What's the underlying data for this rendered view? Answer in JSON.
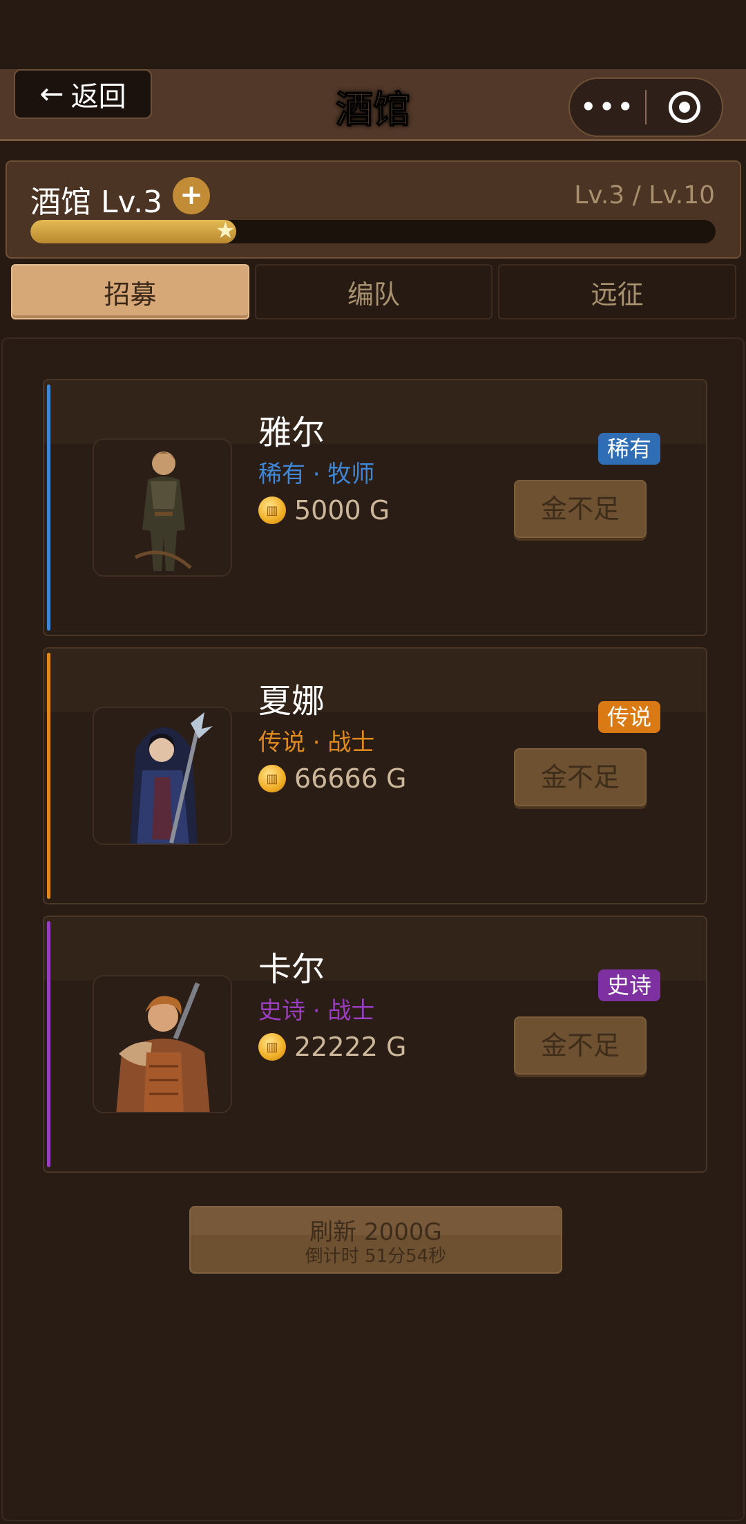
{
  "header": {
    "back_arrow": "←",
    "back_label": "返回",
    "title": "酒馆",
    "more_icon": "•••"
  },
  "level": {
    "name": "酒馆 Lv.3",
    "plus": "+",
    "range": "Lv.3 / Lv.10",
    "progress": 0.3,
    "star": "★"
  },
  "tabs": [
    {
      "label": "招募",
      "active": true
    },
    {
      "label": "编队",
      "active": false
    },
    {
      "label": "远征",
      "active": false
    }
  ],
  "heroes": [
    {
      "name": "雅尔",
      "sub": "稀有 · 牧师",
      "price": "5000 G",
      "badge": "稀有",
      "button": "金不足",
      "rarity_color": "#3f86d6",
      "badge_color": "#2f6db4"
    },
    {
      "name": "夏娜",
      "sub": "传说 · 战士",
      "price": "66666 G",
      "badge": "传说",
      "button": "金不足",
      "rarity_color": "#e08a1e",
      "badge_color": "#d97a14"
    },
    {
      "name": "卡尔",
      "sub": "史诗 · 战士",
      "price": "22222 G",
      "badge": "史诗",
      "button": "金不足",
      "rarity_color": "#9b3dc0",
      "badge_color": "#7e2fa0"
    }
  ],
  "refresh": {
    "label": "刷新 2000G",
    "timer": "倒计时 51分54秒"
  }
}
